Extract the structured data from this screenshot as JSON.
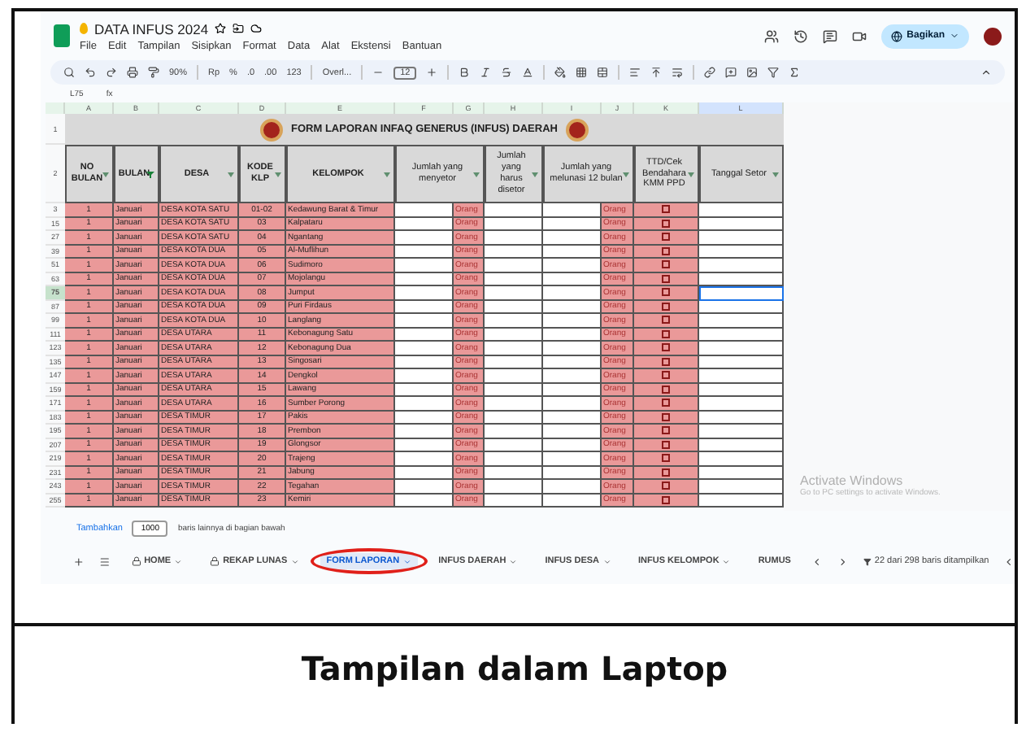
{
  "app": {
    "title": "DATA INFUS 2024",
    "menu": [
      "File",
      "Edit",
      "Tampilan",
      "Sisipkan",
      "Format",
      "Data",
      "Alat",
      "Ekstensi",
      "Bantuan"
    ],
    "share_button": "Bagikan"
  },
  "toolbar": {
    "zoom": "90%",
    "currency": "Rp",
    "percent": "%",
    "decrease_decimal": ".0",
    "increase_decimal": ".00",
    "number_format": "123",
    "font": "Overl...",
    "font_size": "12"
  },
  "formula_bar": {
    "cell": "L75",
    "fx": "fx"
  },
  "columns": [
    {
      "letter": "A",
      "selected": false
    },
    {
      "letter": "B",
      "selected": false
    },
    {
      "letter": "C",
      "selected": false
    },
    {
      "letter": "D",
      "selected": false
    },
    {
      "letter": "E",
      "selected": false
    },
    {
      "letter": "F",
      "selected": false
    },
    {
      "letter": "G",
      "selected": false
    },
    {
      "letter": "H",
      "selected": false
    },
    {
      "letter": "I",
      "selected": false
    },
    {
      "letter": "J",
      "selected": false
    },
    {
      "letter": "K",
      "selected": false
    },
    {
      "letter": "L",
      "selected": true
    }
  ],
  "sheet": {
    "title_row": "1",
    "title": "FORM LAPORAN INFAQ GENERUS (INFUS) DAERAH",
    "header_row": "2",
    "headers": [
      {
        "label": "NO BULAN",
        "filter_active": false
      },
      {
        "label": "BULAN",
        "filter_active": true
      },
      {
        "label": "DESA",
        "filter_active": false
      },
      {
        "label": "KODE KLP",
        "filter_active": false
      },
      {
        "label": "KELOMPOK",
        "filter_active": false
      },
      {
        "label": "Jumlah yang menyetor",
        "filter_active": false
      },
      {
        "label": "Jumlah yang harus disetor",
        "filter_active": false
      },
      {
        "label": "Jumlah yang melunasi 12 bulan",
        "filter_active": false
      },
      {
        "label": "TTD/Cek Bendahara KMM PPD",
        "filter_active": false
      },
      {
        "label": "Tanggal Setor",
        "filter_active": false
      }
    ],
    "rows": [
      {
        "row": "3",
        "no": "1",
        "bulan": "Januari",
        "desa": "DESA KOTA SATU",
        "kode": "01-02",
        "kelompok": "Kedawung Barat & Timur",
        "unit_a": "Orang",
        "unit_b": "Orang",
        "checked": false,
        "selected": false
      },
      {
        "row": "15",
        "no": "1",
        "bulan": "Januari",
        "desa": "DESA KOTA SATU",
        "kode": "03",
        "kelompok": "Kalpataru",
        "unit_a": "Orang",
        "unit_b": "Orang",
        "checked": false,
        "selected": false
      },
      {
        "row": "27",
        "no": "1",
        "bulan": "Januari",
        "desa": "DESA KOTA SATU",
        "kode": "04",
        "kelompok": "Ngantang",
        "unit_a": "Orang",
        "unit_b": "Orang",
        "checked": false,
        "selected": false
      },
      {
        "row": "39",
        "no": "1",
        "bulan": "Januari",
        "desa": "DESA KOTA DUA",
        "kode": "05",
        "kelompok": "Al-Muflihun",
        "unit_a": "Orang",
        "unit_b": "Orang",
        "checked": false,
        "selected": false
      },
      {
        "row": "51",
        "no": "1",
        "bulan": "Januari",
        "desa": "DESA KOTA DUA",
        "kode": "06",
        "kelompok": "Sudimoro",
        "unit_a": "Orang",
        "unit_b": "Orang",
        "checked": false,
        "selected": false
      },
      {
        "row": "63",
        "no": "1",
        "bulan": "Januari",
        "desa": "DESA KOTA DUA",
        "kode": "07",
        "kelompok": "Mojolangu",
        "unit_a": "Orang",
        "unit_b": "Orang",
        "checked": false,
        "selected": false
      },
      {
        "row": "75",
        "no": "1",
        "bulan": "Januari",
        "desa": "DESA KOTA DUA",
        "kode": "08",
        "kelompok": "Jumput",
        "unit_a": "Orang",
        "unit_b": "Orang",
        "checked": false,
        "selected": true
      },
      {
        "row": "87",
        "no": "1",
        "bulan": "Januari",
        "desa": "DESA KOTA DUA",
        "kode": "09",
        "kelompok": "Puri Firdaus",
        "unit_a": "Orang",
        "unit_b": "Orang",
        "checked": false,
        "selected": false
      },
      {
        "row": "99",
        "no": "1",
        "bulan": "Januari",
        "desa": "DESA KOTA DUA",
        "kode": "10",
        "kelompok": "Langlang",
        "unit_a": "Orang",
        "unit_b": "Orang",
        "checked": false,
        "selected": false
      },
      {
        "row": "111",
        "no": "1",
        "bulan": "Januari",
        "desa": "DESA UTARA",
        "kode": "11",
        "kelompok": "Kebonagung Satu",
        "unit_a": "Orang",
        "unit_b": "Orang",
        "checked": false,
        "selected": false
      },
      {
        "row": "123",
        "no": "1",
        "bulan": "Januari",
        "desa": "DESA UTARA",
        "kode": "12",
        "kelompok": "Kebonagung Dua",
        "unit_a": "Orang",
        "unit_b": "Orang",
        "checked": false,
        "selected": false
      },
      {
        "row": "135",
        "no": "1",
        "bulan": "Januari",
        "desa": "DESA UTARA",
        "kode": "13",
        "kelompok": "Singosari",
        "unit_a": "Orang",
        "unit_b": "Orang",
        "checked": false,
        "selected": false
      },
      {
        "row": "147",
        "no": "1",
        "bulan": "Januari",
        "desa": "DESA UTARA",
        "kode": "14",
        "kelompok": "Dengkol",
        "unit_a": "Orang",
        "unit_b": "Orang",
        "checked": false,
        "selected": false
      },
      {
        "row": "159",
        "no": "1",
        "bulan": "Januari",
        "desa": "DESA UTARA",
        "kode": "15",
        "kelompok": "Lawang",
        "unit_a": "Orang",
        "unit_b": "Orang",
        "checked": false,
        "selected": false
      },
      {
        "row": "171",
        "no": "1",
        "bulan": "Januari",
        "desa": "DESA UTARA",
        "kode": "16",
        "kelompok": "Sumber Porong",
        "unit_a": "Orang",
        "unit_b": "Orang",
        "checked": false,
        "selected": false
      },
      {
        "row": "183",
        "no": "1",
        "bulan": "Januari",
        "desa": "DESA TIMUR",
        "kode": "17",
        "kelompok": "Pakis",
        "unit_a": "Orang",
        "unit_b": "Orang",
        "checked": false,
        "selected": false
      },
      {
        "row": "195",
        "no": "1",
        "bulan": "Januari",
        "desa": "DESA TIMUR",
        "kode": "18",
        "kelompok": "Prembon",
        "unit_a": "Orang",
        "unit_b": "Orang",
        "checked": false,
        "selected": false
      },
      {
        "row": "207",
        "no": "1",
        "bulan": "Januari",
        "desa": "DESA TIMUR",
        "kode": "19",
        "kelompok": "Glongsor",
        "unit_a": "Orang",
        "unit_b": "Orang",
        "checked": false,
        "selected": false
      },
      {
        "row": "219",
        "no": "1",
        "bulan": "Januari",
        "desa": "DESA TIMUR",
        "kode": "20",
        "kelompok": "Trajeng",
        "unit_a": "Orang",
        "unit_b": "Orang",
        "checked": false,
        "selected": false
      },
      {
        "row": "231",
        "no": "1",
        "bulan": "Januari",
        "desa": "DESA TIMUR",
        "kode": "21",
        "kelompok": "Jabung",
        "unit_a": "Orang",
        "unit_b": "Orang",
        "checked": false,
        "selected": false
      },
      {
        "row": "243",
        "no": "1",
        "bulan": "Januari",
        "desa": "DESA TIMUR",
        "kode": "22",
        "kelompok": "Tegahan",
        "unit_a": "Orang",
        "unit_b": "Orang",
        "checked": false,
        "selected": false
      },
      {
        "row": "255",
        "no": "1",
        "bulan": "Januari",
        "desa": "DESA TIMUR",
        "kode": "23",
        "kelompok": "Kemiri",
        "unit_a": "Orang",
        "unit_b": "Orang",
        "checked": false,
        "selected": false
      }
    ]
  },
  "add_rows": {
    "button": "Tambahkan",
    "count": "1000",
    "suffix": "baris lainnya di bagian bawah"
  },
  "activation_notice": {
    "title": "Activate Windows",
    "subtitle": "Go to PC settings to activate Windows."
  },
  "tabs": [
    {
      "label": "HOME",
      "locked": true,
      "selected": false,
      "circled": false
    },
    {
      "label": "REKAP LUNAS",
      "locked": true,
      "selected": false,
      "circled": false
    },
    {
      "label": "FORM LAPORAN",
      "locked": false,
      "selected": true,
      "circled": true
    },
    {
      "label": "INFUS DAERAH",
      "locked": false,
      "selected": false,
      "circled": false
    },
    {
      "label": "INFUS DESA",
      "locked": false,
      "selected": false,
      "circled": false
    },
    {
      "label": "INFUS KELOMPOK",
      "locked": false,
      "selected": false,
      "circled": false
    },
    {
      "label": "RUMUS",
      "locked": false,
      "selected": false,
      "circled": false
    }
  ],
  "status": "22 dari 298 baris ditampilkan",
  "caption": "Tampilan dalam Laptop"
}
